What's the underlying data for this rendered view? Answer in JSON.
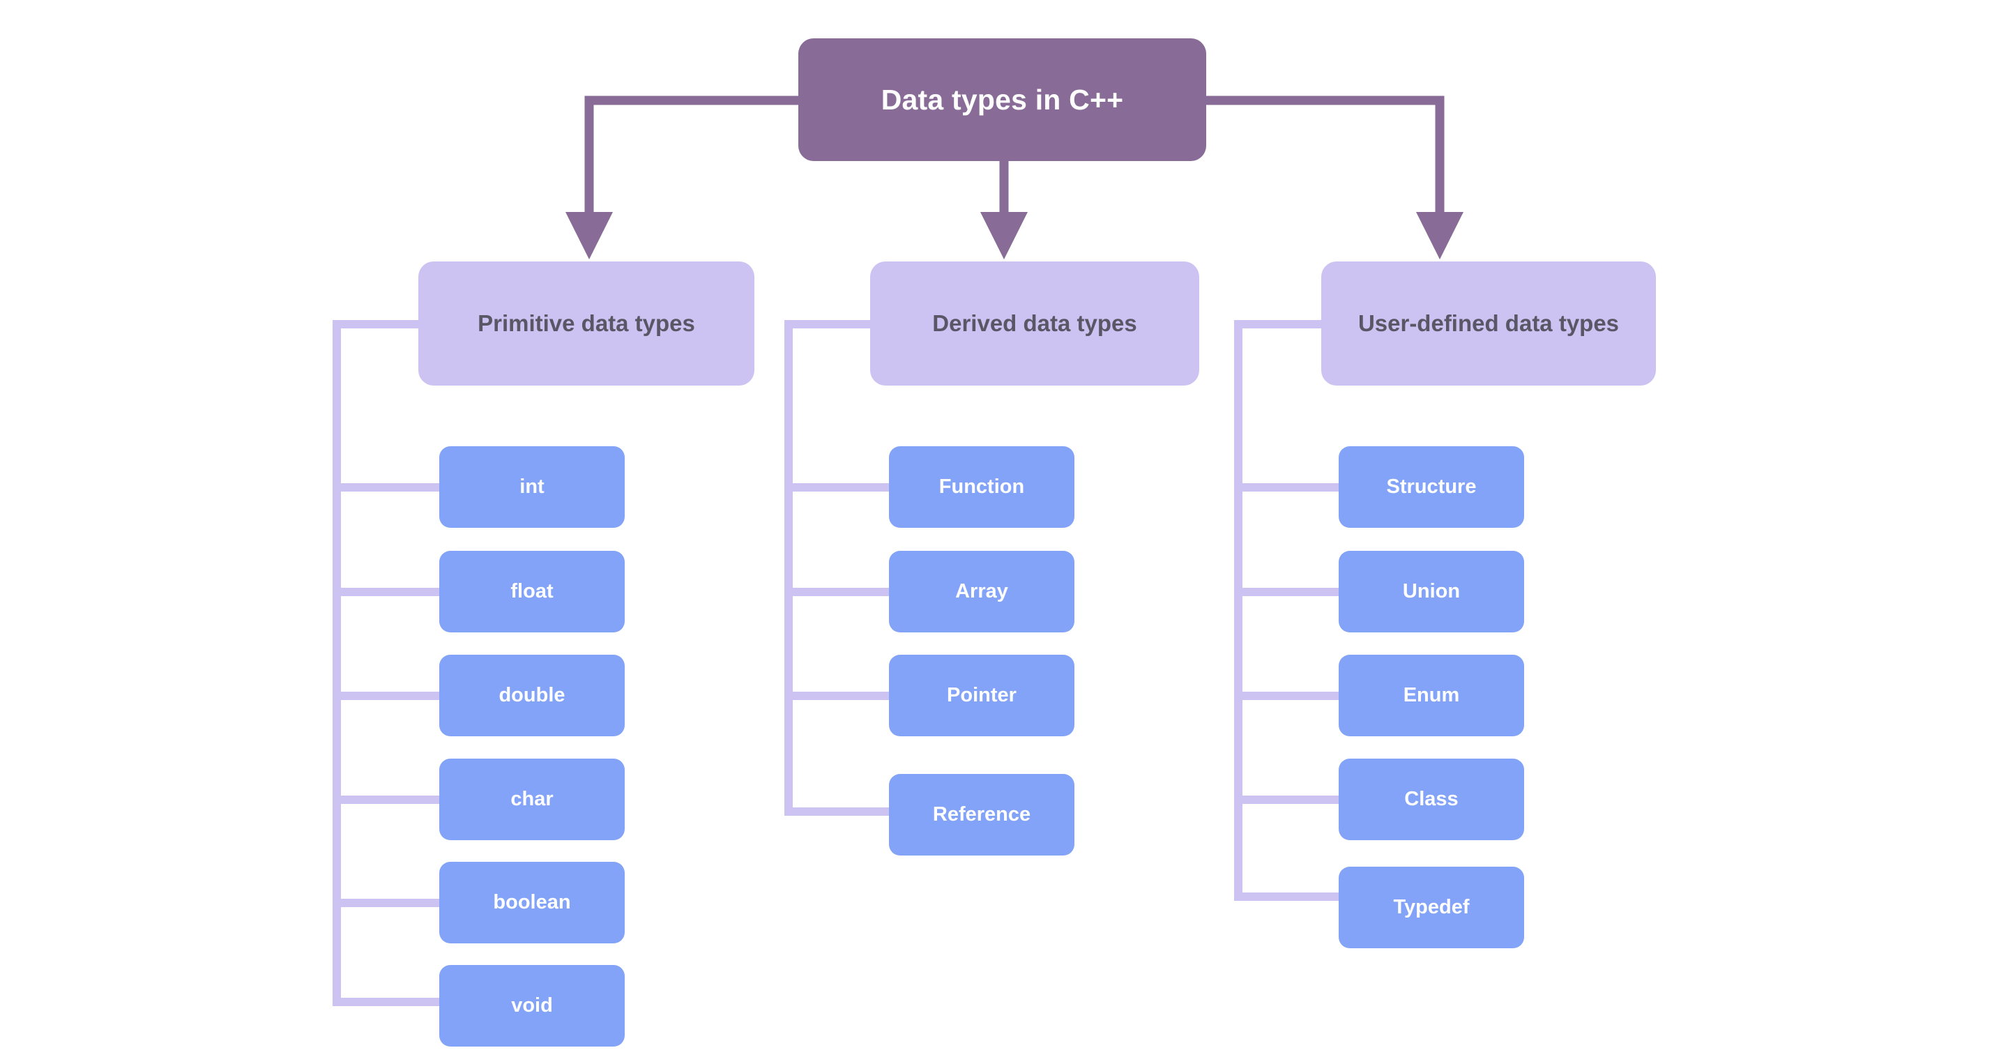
{
  "diagram": {
    "title": "Data types in C++",
    "type": "hierarchy-tree",
    "colors": {
      "root_fill": "#886b97",
      "root_text": "#ffffff",
      "category_fill": "#cdc3f2",
      "category_text": "#595766",
      "leaf_fill": "#82a3f8",
      "leaf_text": "#ffffff",
      "arrow_stroke": "#886b97",
      "branch_stroke": "#cdc3f2",
      "background": "#ffffff"
    },
    "root": {
      "label": "Data types in C++"
    },
    "categories": [
      {
        "id": "primitive",
        "label": "Primitive data types",
        "children": [
          {
            "label": "int"
          },
          {
            "label": "float"
          },
          {
            "label": "double"
          },
          {
            "label": "char"
          },
          {
            "label": "boolean"
          },
          {
            "label": "void"
          }
        ]
      },
      {
        "id": "derived",
        "label": "Derived data types",
        "children": [
          {
            "label": "Function"
          },
          {
            "label": "Array"
          },
          {
            "label": "Pointer"
          },
          {
            "label": "Reference"
          }
        ]
      },
      {
        "id": "user-defined",
        "label": "User-defined data types",
        "children": [
          {
            "label": "Structure"
          },
          {
            "label": "Union"
          },
          {
            "label": "Enum"
          },
          {
            "label": "Class"
          },
          {
            "label": "Typedef"
          }
        ]
      }
    ]
  }
}
